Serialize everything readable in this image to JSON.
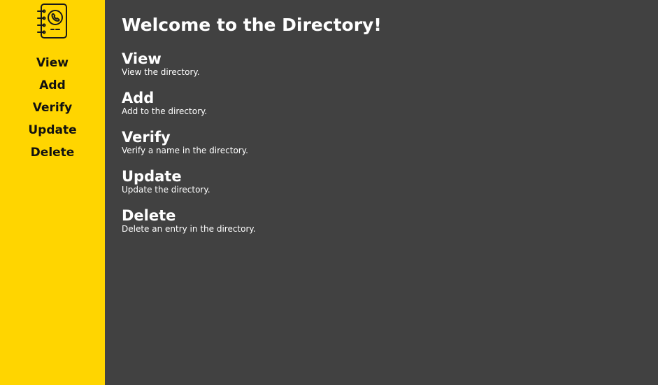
{
  "colors": {
    "sidebar_bg": "#FFD500",
    "main_bg": "#414141",
    "text_light": "#FFFFFF",
    "text_dark": "#111111"
  },
  "sidebar": {
    "logo_icon": "phone-book-icon",
    "items": [
      {
        "label": "View"
      },
      {
        "label": "Add"
      },
      {
        "label": "Verify"
      },
      {
        "label": "Update"
      },
      {
        "label": "Delete"
      }
    ]
  },
  "main": {
    "title": "Welcome to the Directory!",
    "sections": [
      {
        "title": "View",
        "description": "View the directory."
      },
      {
        "title": "Add",
        "description": "Add to the directory."
      },
      {
        "title": "Verify",
        "description": "Verify a name in the directory."
      },
      {
        "title": "Update",
        "description": "Update the directory."
      },
      {
        "title": "Delete",
        "description": "Delete an entry in the directory."
      }
    ]
  }
}
